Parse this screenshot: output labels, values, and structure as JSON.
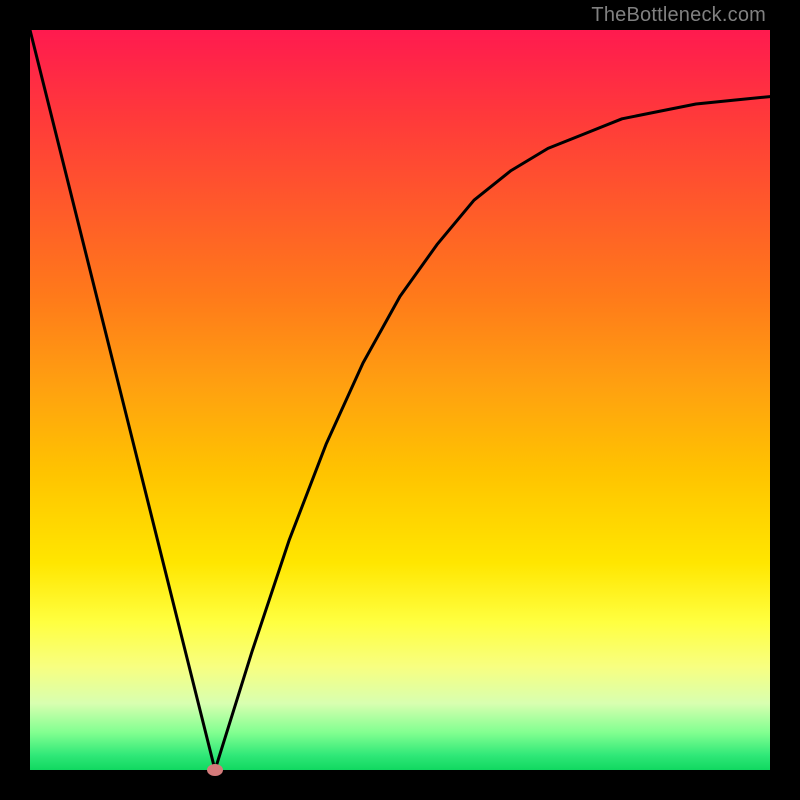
{
  "watermark": "TheBottleneck.com",
  "colors": {
    "background": "#000000",
    "gradient_top": "#ff1a4f",
    "gradient_bottom": "#10d860",
    "curve": "#000000",
    "marker": "#d47a7a"
  },
  "chart_data": {
    "type": "line",
    "title": "",
    "xlabel": "",
    "ylabel": "",
    "xlim": [
      0,
      100
    ],
    "ylim": [
      0,
      100
    ],
    "legend": false,
    "grid": false,
    "marker": {
      "x": 25,
      "y": 0
    },
    "series": [
      {
        "name": "bottleneck-curve",
        "x": [
          0,
          5,
          10,
          15,
          20,
          25,
          30,
          35,
          40,
          45,
          50,
          55,
          60,
          65,
          70,
          75,
          80,
          85,
          90,
          95,
          100
        ],
        "values": [
          100,
          80,
          60,
          40,
          20,
          0,
          16,
          31,
          44,
          55,
          64,
          71,
          77,
          81,
          84,
          86,
          88,
          89,
          90,
          90.5,
          91
        ]
      }
    ]
  }
}
